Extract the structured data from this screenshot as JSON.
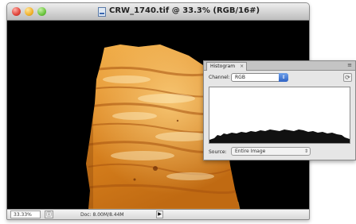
{
  "window": {
    "title": "CRW_1740.tif @ 33.3% (RGB/16#)"
  },
  "statusbar": {
    "zoom": "33.33%",
    "doc_size": "Doc: 8.00M/8.44M",
    "menu_arrow": "▶"
  },
  "histogram": {
    "tab_label": "Histogram",
    "tab_close": "×",
    "menu_icon": "≡",
    "channel_label": "Channel:",
    "channel_value": "RGB",
    "source_label": "Source:",
    "source_value": "Entire Image",
    "select_arrows": "⇕",
    "refresh_icon": "⟳"
  },
  "colors": {
    "canvas": "#000000",
    "amber_light": "#f6c062",
    "amber_mid": "#e08a22",
    "amber_dark": "#a84f0c"
  },
  "icons": [
    "close-button",
    "minimize-button",
    "zoom-button",
    "document-icon",
    "refresh-icon",
    "panel-menu-icon"
  ]
}
